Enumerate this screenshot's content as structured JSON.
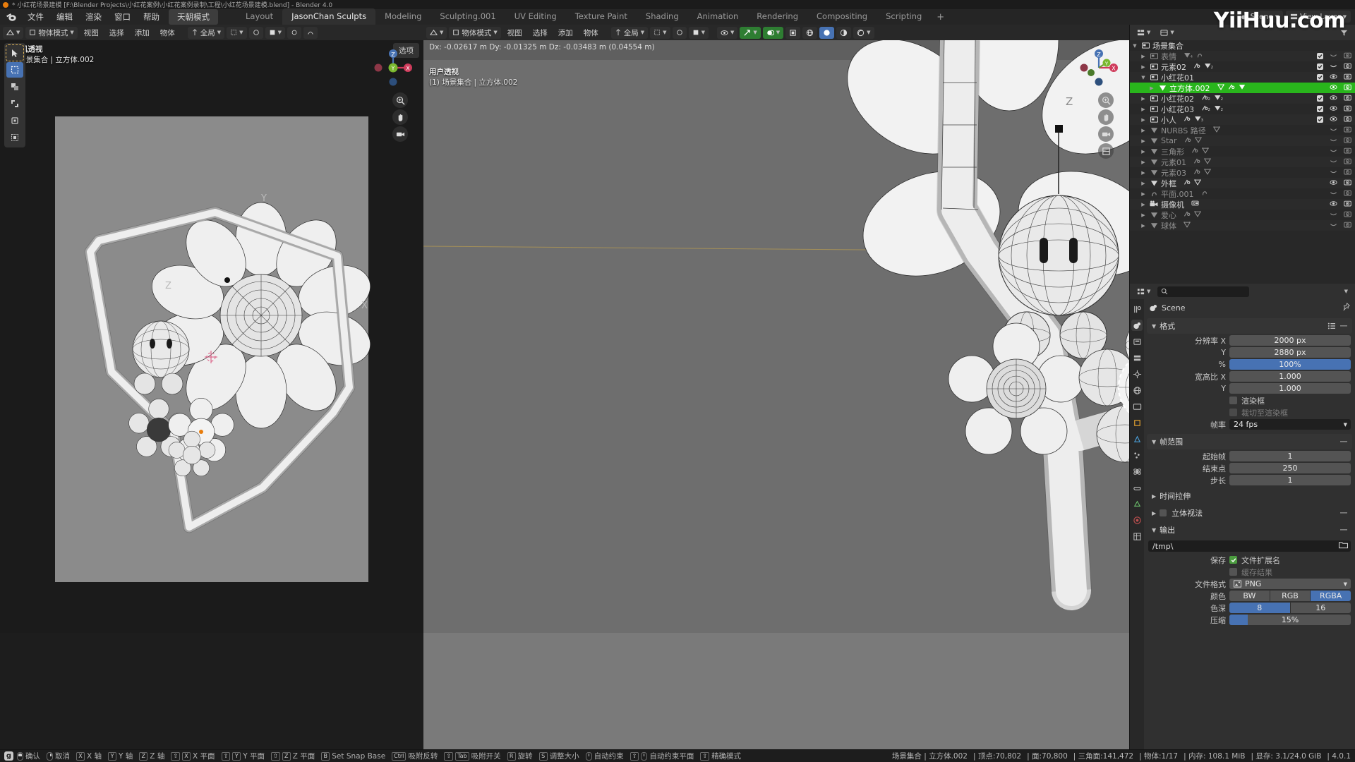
{
  "titlebar": {
    "text": "* 小红花场景建模 [F:\\Blender Projects\\小红花案例\\小红花案例录制\\工程\\小红花场景建模.blend] - Blender 4.0"
  },
  "watermark": "YiiHuu.com",
  "topmenu": {
    "items": [
      "文件",
      "编辑",
      "渲染",
      "窗口",
      "帮助"
    ],
    "mode_pill": "天朝模式",
    "workspaces": [
      {
        "label": "Layout",
        "active": false
      },
      {
        "label": "JasonChan Sculpts",
        "active": true
      },
      {
        "label": "Modeling",
        "active": false
      },
      {
        "label": "Sculpting.001",
        "active": false
      },
      {
        "label": "UV Editing",
        "active": false
      },
      {
        "label": "Texture Paint",
        "active": false
      },
      {
        "label": "Shading",
        "active": false
      },
      {
        "label": "Animation",
        "active": false
      },
      {
        "label": "Rendering",
        "active": false
      },
      {
        "label": "Compositing",
        "active": false
      },
      {
        "label": "Scripting",
        "active": false
      }
    ],
    "add_workspace": "+",
    "scene_name": "Scene",
    "viewlayer_name": "View Layer"
  },
  "viewport_left": {
    "header": {
      "mode": "物体模式",
      "menus": [
        "视图",
        "选择",
        "添加",
        "物体"
      ],
      "transform_orient": "全局",
      "select_label": "选项"
    },
    "overlay_line1": "摄像机透视",
    "overlay_line2": "(1) 场景集合 | 立方体.002"
  },
  "viewport_right": {
    "header": {
      "mode": "物体模式",
      "menus": [
        "视图",
        "选择",
        "添加",
        "物体"
      ],
      "transform_orient": "全局"
    },
    "delta_info": "Dx: -0.02617 m   Dy: -0.01325 m   Dz: -0.03483 m (0.04554 m)",
    "overlay_line1": "用户透视",
    "overlay_line2": "(1) 场景集合 | 立方体.002"
  },
  "outliner": {
    "root": "场景集合",
    "rows": [
      {
        "name": "表情",
        "indent": 1,
        "type": "collection",
        "dim": true,
        "selected": false,
        "checkbox": true,
        "eye": "closed",
        "camera": true,
        "data_icons": [
          "mesh-4",
          "curve"
        ]
      },
      {
        "name": "元素02",
        "indent": 1,
        "type": "collection",
        "dim": false,
        "selected": false,
        "checkbox": true,
        "eye": "closed",
        "camera": true,
        "data_icons": [
          "modifier",
          "mesh-2"
        ]
      },
      {
        "name": "小红花01",
        "indent": 1,
        "type": "collection",
        "dim": false,
        "selected": false,
        "checkbox": true,
        "eye": "open",
        "camera": true,
        "expanded": true,
        "data_icons": []
      },
      {
        "name": "立方体.002",
        "indent": 2,
        "type": "mesh",
        "dim": false,
        "selected": true,
        "checkbox": false,
        "eye": "open",
        "camera": true,
        "data_icons": [
          "mesh-data",
          "modifier",
          "mesh"
        ]
      },
      {
        "name": "小红花02",
        "indent": 1,
        "type": "collection",
        "dim": false,
        "selected": false,
        "checkbox": true,
        "eye": "open",
        "camera": true,
        "data_icons": [
          "modifier-2",
          "mesh-2"
        ]
      },
      {
        "name": "小红花03",
        "indent": 1,
        "type": "collection",
        "dim": false,
        "selected": false,
        "checkbox": true,
        "eye": "open",
        "camera": true,
        "data_icons": [
          "modifier-2",
          "mesh-2"
        ]
      },
      {
        "name": "小人",
        "indent": 1,
        "type": "collection",
        "dim": false,
        "selected": false,
        "checkbox": true,
        "eye": "open",
        "camera": true,
        "data_icons": [
          "modifier",
          "mesh-3"
        ]
      },
      {
        "name": "NURBS 路径",
        "indent": 1,
        "type": "mesh",
        "dim": true,
        "selected": false,
        "checkbox": false,
        "eye": "closed",
        "camera": true,
        "data_icons": [
          "mesh-data"
        ]
      },
      {
        "name": "Star",
        "indent": 1,
        "type": "mesh",
        "dim": true,
        "selected": false,
        "checkbox": false,
        "eye": "closed",
        "camera": true,
        "data_icons": [
          "modifier",
          "mesh-data"
        ]
      },
      {
        "name": "三角形",
        "indent": 1,
        "type": "mesh",
        "dim": true,
        "selected": false,
        "checkbox": false,
        "eye": "closed",
        "camera": true,
        "data_icons": [
          "modifier",
          "mesh-data"
        ]
      },
      {
        "name": "元素01",
        "indent": 1,
        "type": "mesh",
        "dim": true,
        "selected": false,
        "checkbox": false,
        "eye": "closed",
        "camera": true,
        "data_icons": [
          "modifier",
          "mesh-data"
        ]
      },
      {
        "name": "元素03",
        "indent": 1,
        "type": "mesh",
        "dim": true,
        "selected": false,
        "checkbox": false,
        "eye": "closed",
        "camera": true,
        "data_icons": [
          "modifier",
          "mesh-data"
        ]
      },
      {
        "name": "外框",
        "indent": 1,
        "type": "mesh",
        "dim": false,
        "selected": false,
        "checkbox": false,
        "eye": "open",
        "camera": true,
        "data_icons": [
          "modifier",
          "mesh-data"
        ]
      },
      {
        "name": "平面.001",
        "indent": 1,
        "type": "curve",
        "dim": true,
        "selected": false,
        "checkbox": false,
        "eye": "closed",
        "camera": true,
        "data_icons": [
          "curve"
        ]
      },
      {
        "name": "摄像机",
        "indent": 1,
        "type": "camera",
        "dim": false,
        "selected": false,
        "checkbox": false,
        "eye": "open",
        "camera": true,
        "data_icons": [
          "camera-data"
        ]
      },
      {
        "name": "爱心",
        "indent": 1,
        "type": "mesh",
        "dim": true,
        "selected": false,
        "checkbox": false,
        "eye": "closed",
        "camera": true,
        "data_icons": [
          "modifier",
          "mesh-data"
        ]
      },
      {
        "name": "球体",
        "indent": 1,
        "type": "mesh",
        "dim": true,
        "selected": false,
        "checkbox": false,
        "eye": "closed",
        "camera": true,
        "data_icons": [
          "mesh-data"
        ]
      }
    ]
  },
  "properties": {
    "search_placeholder": "",
    "breadcrumb": "Scene",
    "panels": {
      "format": {
        "title": "格式",
        "rows": [
          {
            "label": "分辨率 X",
            "value": "2000 px",
            "style": "normal"
          },
          {
            "label": "Y",
            "value": "2880 px",
            "style": "normal"
          },
          {
            "label": "%",
            "value": "100%",
            "style": "blue"
          },
          {
            "label": "宽高比 X",
            "value": "1.000",
            "style": "normal"
          },
          {
            "label": "Y",
            "value": "1.000",
            "style": "normal"
          }
        ],
        "checks": [
          {
            "label": "渲染框",
            "checked": false,
            "disabled": false
          },
          {
            "label": "裁切至渲染框",
            "checked": false,
            "disabled": true
          }
        ],
        "framerate_label": "帧率",
        "framerate_value": "24 fps"
      },
      "frame_range": {
        "title": "帧范围",
        "rows": [
          {
            "label": "起始帧",
            "value": "1"
          },
          {
            "label": "结束点",
            "value": "250"
          },
          {
            "label": "步长",
            "value": "1"
          }
        ]
      },
      "time_stretch": {
        "title": "时间拉伸"
      },
      "stereoscopy": {
        "title": "立体视法"
      },
      "output": {
        "title": "输出",
        "path": "/tmp\\",
        "save_label": "保存",
        "save_ext_label": "文件扩展名",
        "save_ext_checked": true,
        "cache_label": "缓存结果",
        "cache_checked": false,
        "fileformat_label": "文件格式",
        "fileformat_value": "PNG",
        "color_label": "颜色",
        "color_options": [
          "BW",
          "RGB",
          "RGBA"
        ],
        "color_selected": "RGBA",
        "depth_label": "色深",
        "depth_options": [
          "8",
          "16"
        ],
        "depth_selected": "8",
        "compression_label": "压缩",
        "compression_value": "15%",
        "compression_percent": 15
      }
    }
  },
  "statusbar": {
    "gizmo_key": "g",
    "items": [
      {
        "keys": [
          "mouse-left"
        ],
        "label": "确认"
      },
      {
        "keys": [
          "mouse-right"
        ],
        "label": "取消"
      },
      {
        "keys": [
          "X"
        ],
        "label": "X 轴"
      },
      {
        "keys": [
          "Y"
        ],
        "label": "Y 轴"
      },
      {
        "keys": [
          "Z"
        ],
        "label": "Z 轴"
      },
      {
        "keys": [
          "⇧",
          "X"
        ],
        "label": "X 平面"
      },
      {
        "keys": [
          "⇧",
          "Y"
        ],
        "label": "Y 平面"
      },
      {
        "keys": [
          "⇧",
          "Z"
        ],
        "label": "Z 平面"
      },
      {
        "keys": [
          "B"
        ],
        "label": "Set Snap Base"
      },
      {
        "keys": [
          "Ctrl"
        ],
        "label": "吸附反转"
      },
      {
        "keys": [
          "⇧",
          "Tab"
        ],
        "label": "吸附开关"
      },
      {
        "keys": [
          "R"
        ],
        "label": "旋转"
      },
      {
        "keys": [
          "S"
        ],
        "label": "调整大小"
      },
      {
        "keys": [
          "mouse-mid"
        ],
        "label": "自动约束"
      },
      {
        "keys": [
          "⇧",
          "mouse-mid"
        ],
        "label": "自动约束平面"
      },
      {
        "keys": [
          "⇧"
        ],
        "label": "精确模式"
      }
    ],
    "right": [
      "场景集合 | 立方体.002",
      "顶点:70,802",
      "面:70,800",
      "三角面:141,472",
      "物体:1/17",
      "内存: 108.1 MiB",
      "显存: 3.1/24.0 GiB",
      "4.0.1"
    ]
  },
  "colors": {
    "accent_blue": "#4772b3",
    "select_green": "#29b51c",
    "header_bg": "#282828",
    "panel_bg": "#303030",
    "field_bg": "#545454"
  }
}
